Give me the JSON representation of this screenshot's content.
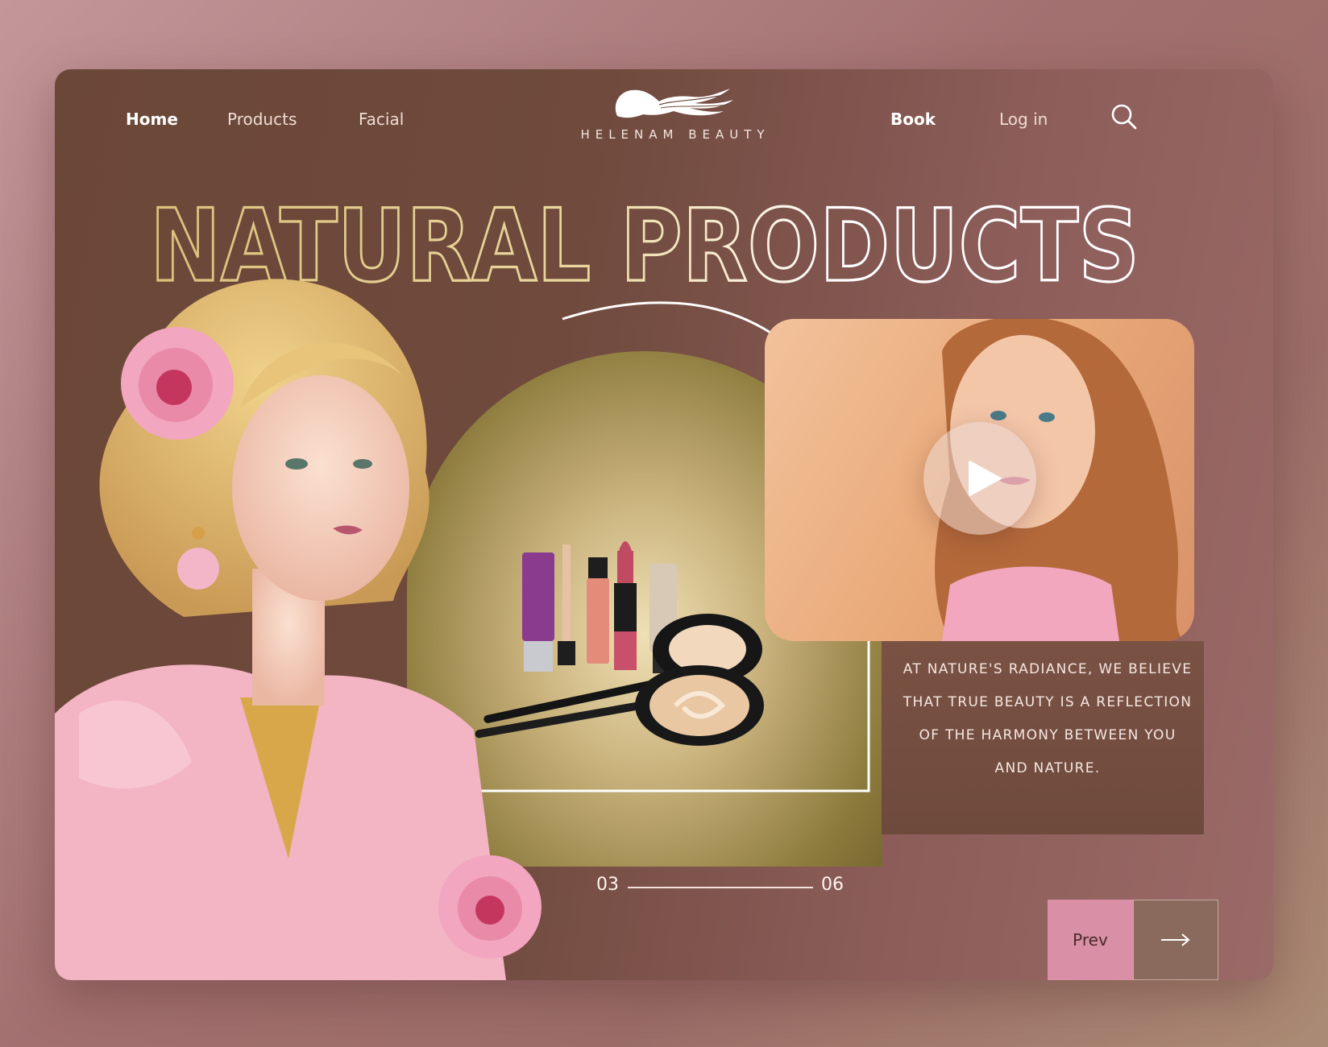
{
  "nav": {
    "left": [
      {
        "label": "Home",
        "active": true
      },
      {
        "label": "Products",
        "active": false
      },
      {
        "label": "Facial",
        "active": false
      }
    ],
    "right": [
      {
        "label": "Book",
        "active": true
      },
      {
        "label": "Log in",
        "active": false
      }
    ],
    "search_icon": "search-icon"
  },
  "brand": {
    "name": "HELENAM BEAUTY",
    "logo_icon": "hair-silhouette-logo"
  },
  "hero": {
    "headline": "NATURAL PRODUCTS",
    "blurb": "AT NATURE'S RADIANCE, WE BELIEVE THAT TRUE BEAUTY IS A REFLECTION OF THE HARMONY BETWEEN YOU AND NATURE."
  },
  "slider": {
    "current": "03",
    "total": "06",
    "prev_label": "Prev",
    "next_icon": "arrow-right-icon"
  },
  "video": {
    "play_icon": "play-icon"
  },
  "colors": {
    "card": "#6f4a3d",
    "accent_pink": "#d98fa6",
    "headline_gold": "#d9c07a",
    "headline_white": "#ffffff"
  }
}
